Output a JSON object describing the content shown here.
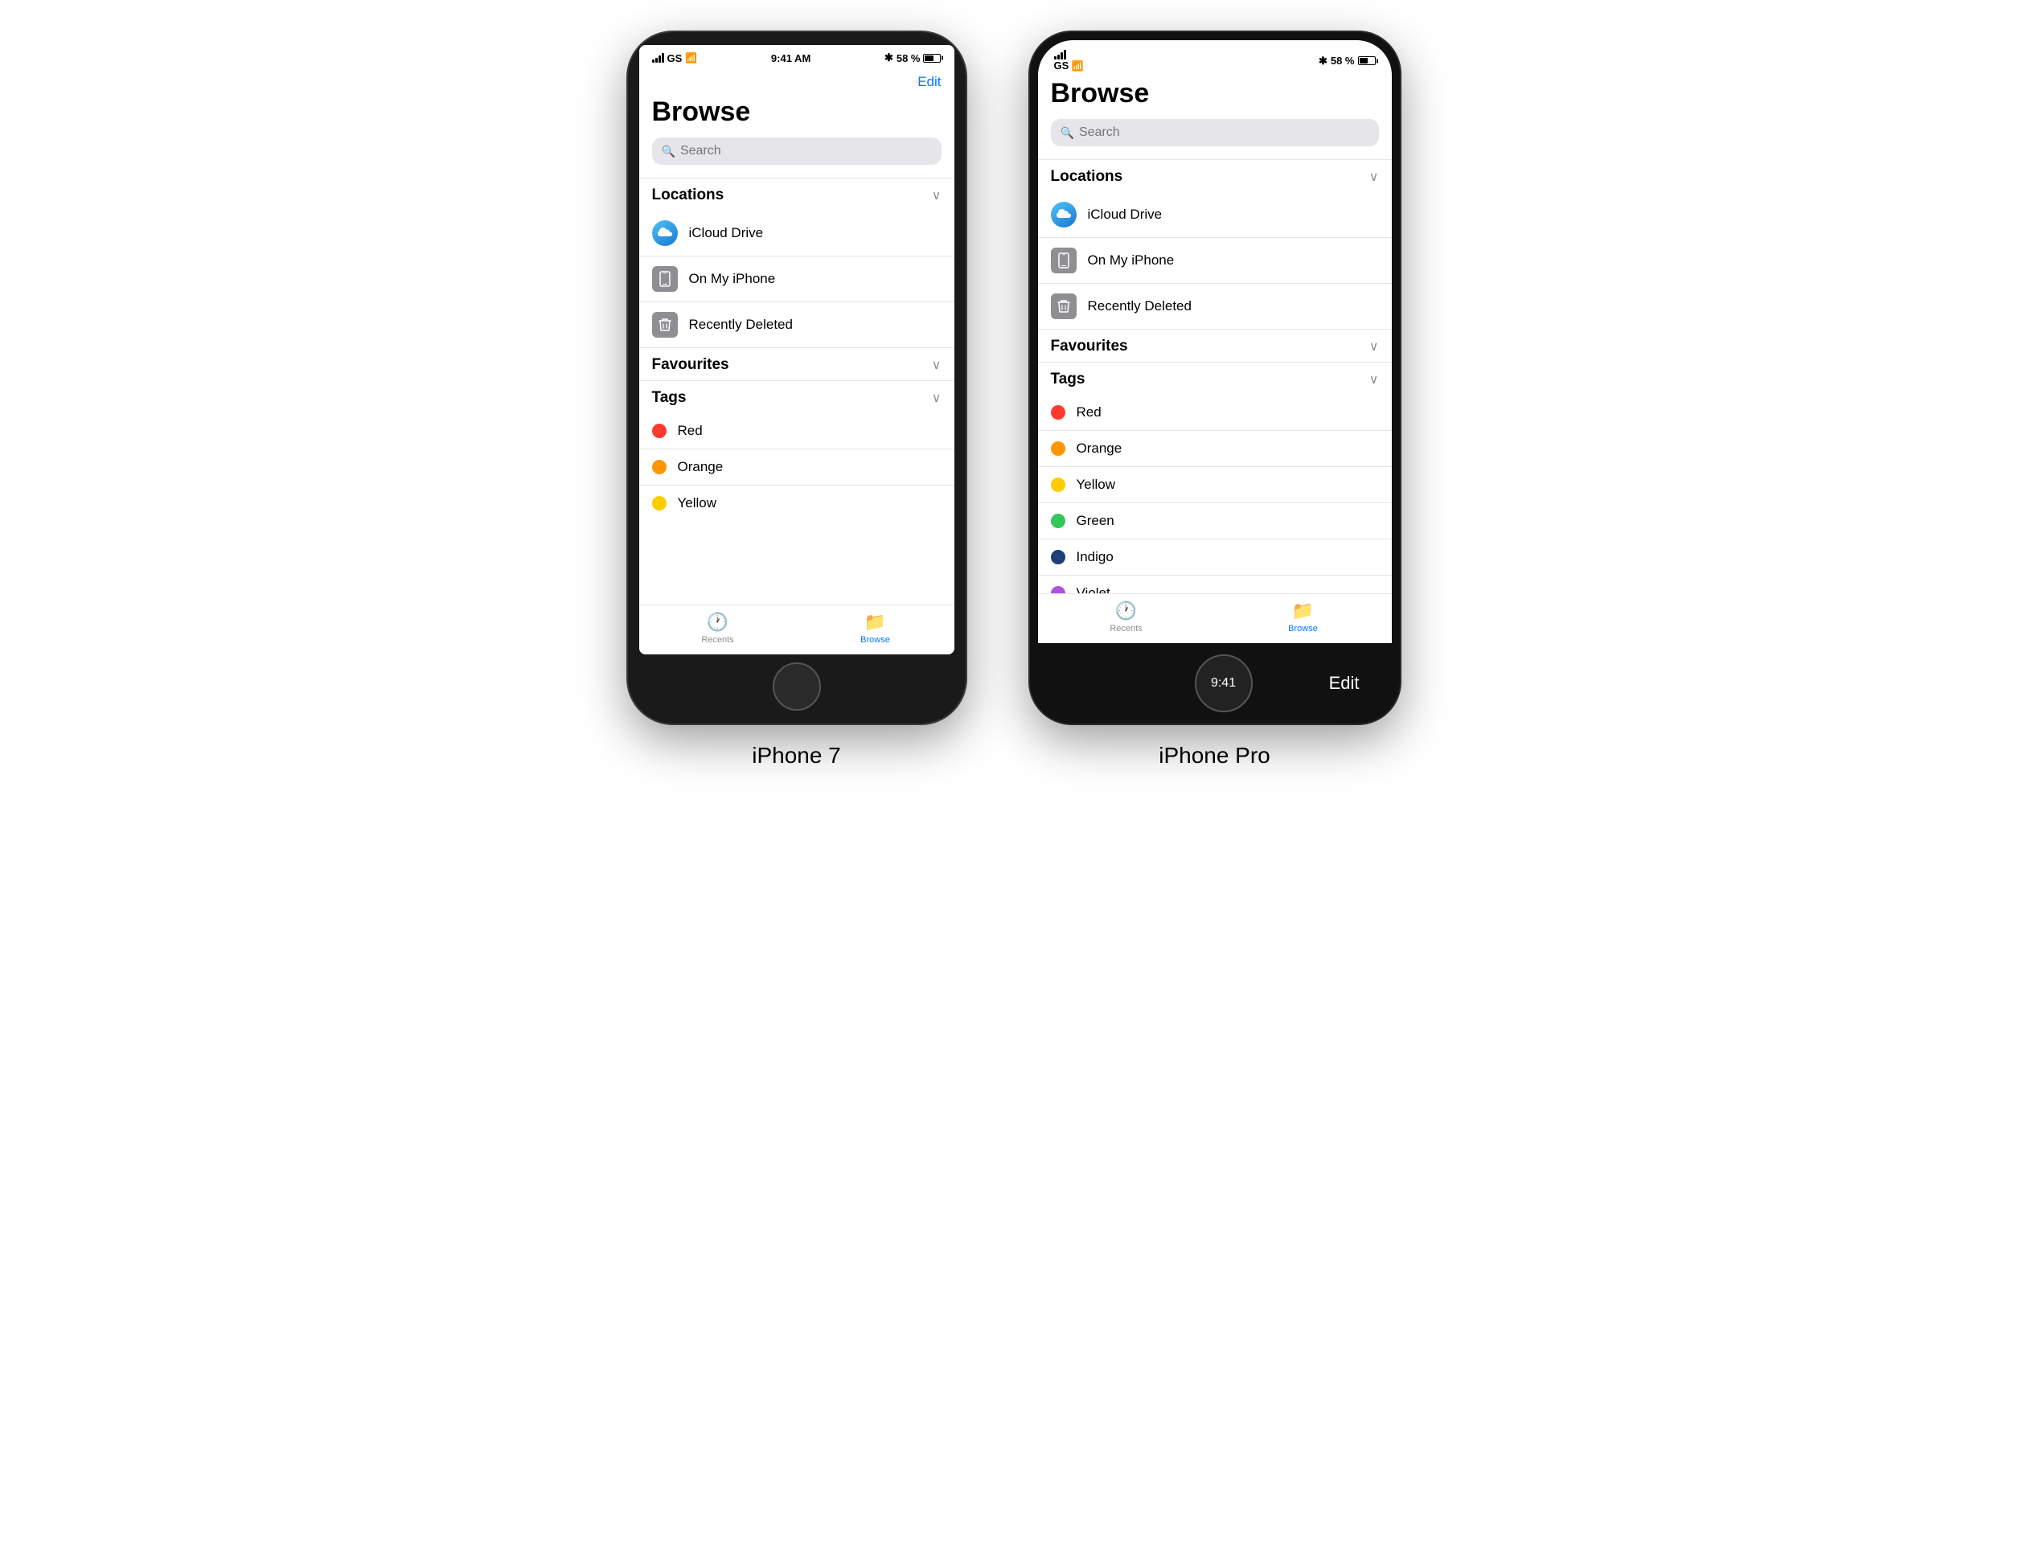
{
  "iphone7": {
    "label": "iPhone 7",
    "status": {
      "signal": "GS",
      "wifi": "wifi",
      "time": "9:41 AM",
      "bluetooth": "BT",
      "battery": "58 %"
    },
    "edit_btn": "Edit",
    "browse_title": "Browse",
    "search_placeholder": "Search",
    "sections": {
      "locations": {
        "title": "Locations",
        "items": [
          {
            "label": "iCloud Drive",
            "type": "icloud"
          },
          {
            "label": "On My iPhone",
            "type": "iphone"
          },
          {
            "label": "Recently Deleted",
            "type": "trash"
          }
        ]
      },
      "favourites": {
        "title": "Favourites"
      },
      "tags": {
        "title": "Tags",
        "items": [
          {
            "label": "Red",
            "color": "#FF3B30"
          },
          {
            "label": "Orange",
            "color": "#FF9500"
          },
          {
            "label": "Yellow",
            "color": "#FFCC00"
          }
        ]
      }
    },
    "tabs": [
      {
        "label": "Recents",
        "active": false
      },
      {
        "label": "Browse",
        "active": true
      }
    ]
  },
  "iphone_pro": {
    "label": "iPhone Pro",
    "status": {
      "signal": "GS",
      "wifi": "wifi",
      "time": "9:41",
      "bluetooth": "BT",
      "battery": "58 %"
    },
    "edit_btn": "Edit",
    "browse_title": "Browse",
    "search_placeholder": "Search",
    "sections": {
      "locations": {
        "title": "Locations",
        "items": [
          {
            "label": "iCloud Drive",
            "type": "icloud"
          },
          {
            "label": "On My iPhone",
            "type": "iphone"
          },
          {
            "label": "Recently Deleted",
            "type": "trash"
          }
        ]
      },
      "favourites": {
        "title": "Favourites"
      },
      "tags": {
        "title": "Tags",
        "items": [
          {
            "label": "Red",
            "color": "#FF3B30"
          },
          {
            "label": "Orange",
            "color": "#FF9500"
          },
          {
            "label": "Yellow",
            "color": "#FFCC00"
          },
          {
            "label": "Green",
            "color": "#34C759"
          },
          {
            "label": "Indigo",
            "color": "#1C3F7A"
          },
          {
            "label": "Violet",
            "color": "#AF52DE"
          }
        ]
      }
    },
    "tabs": [
      {
        "label": "Recents",
        "active": false
      },
      {
        "label": "Browse",
        "active": true
      }
    ]
  }
}
